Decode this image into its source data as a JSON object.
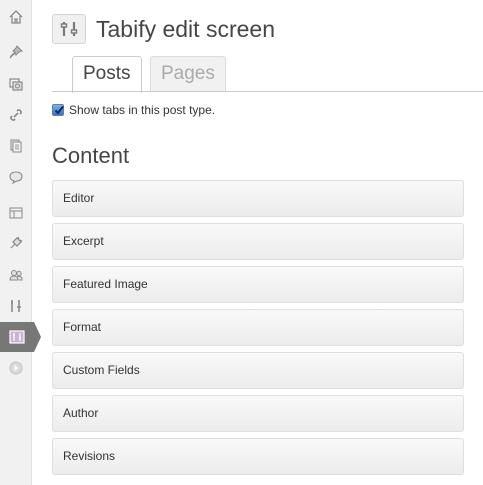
{
  "header": {
    "title": "Tabify edit screen"
  },
  "tabs": [
    {
      "label": "Posts",
      "active": true
    },
    {
      "label": "Pages",
      "active": false
    }
  ],
  "options": {
    "show_tabs_label": "Show tabs in this post type.",
    "show_tabs_checked": true
  },
  "content_section": {
    "title": "Content",
    "items": [
      {
        "label": "Editor"
      },
      {
        "label": "Excerpt"
      },
      {
        "label": "Featured Image"
      },
      {
        "label": "Format"
      },
      {
        "label": "Custom Fields"
      },
      {
        "label": "Author"
      },
      {
        "label": "Revisions"
      }
    ]
  },
  "sidebar": {
    "items": [
      {
        "icon": "home-icon"
      },
      {
        "icon": "pushpin-icon"
      },
      {
        "icon": "media-icon"
      },
      {
        "icon": "link-icon"
      },
      {
        "icon": "pages-icon"
      },
      {
        "icon": "comments-icon"
      },
      {
        "icon": "appearance-icon"
      },
      {
        "icon": "plugins-icon"
      },
      {
        "icon": "users-icon"
      },
      {
        "icon": "tools-icon"
      },
      {
        "icon": "settings-icon",
        "active": true
      },
      {
        "icon": "collapse-icon"
      }
    ]
  },
  "colors": {
    "sidebar_bg": "#f1f1f1",
    "active_menu": "#777777",
    "checkbox_blue": "#2f73d4",
    "text": "#333333",
    "heading": "#464646"
  }
}
